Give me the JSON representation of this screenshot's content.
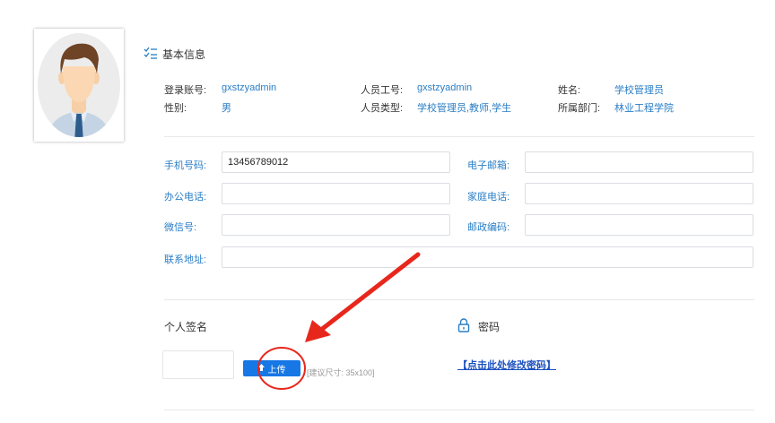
{
  "basic_info": {
    "title": "基本信息",
    "fields": [
      {
        "label": "登录账号:",
        "value": "gxstzyadmin"
      },
      {
        "label": "人员工号:",
        "value": "gxstzyadmin"
      },
      {
        "label": "姓名:",
        "value": "学校管理员"
      },
      {
        "label": "性别:",
        "value": "男"
      },
      {
        "label": "人员类型:",
        "value": "学校管理员,教师,学生"
      },
      {
        "label": "所属部门:",
        "value": "林业工程学院"
      }
    ]
  },
  "contact": {
    "phone": {
      "label": "手机号码:",
      "value": "13456789012"
    },
    "email": {
      "label": "电子邮箱:",
      "value": ""
    },
    "office_phone": {
      "label": "办公电话:",
      "value": ""
    },
    "home_phone": {
      "label": "家庭电话:",
      "value": ""
    },
    "wechat": {
      "label": "微信号:",
      "value": ""
    },
    "postcode": {
      "label": "邮政编码:",
      "value": ""
    },
    "address": {
      "label": "联系地址:",
      "value": ""
    }
  },
  "signature": {
    "title": "个人签名",
    "upload_label": "上传",
    "hint": "[建议尺寸: 35x100]"
  },
  "password": {
    "title": "密码",
    "link": "【点击此处修改密码】"
  },
  "colors": {
    "accent": "#2a7ec5",
    "button": "#1677e5",
    "annotation": "#e8271c"
  },
  "icons": [
    "avatar",
    "checklist-icon",
    "upload-arrow-icon",
    "lock-icon",
    "annotation-arrow",
    "annotation-circle"
  ]
}
